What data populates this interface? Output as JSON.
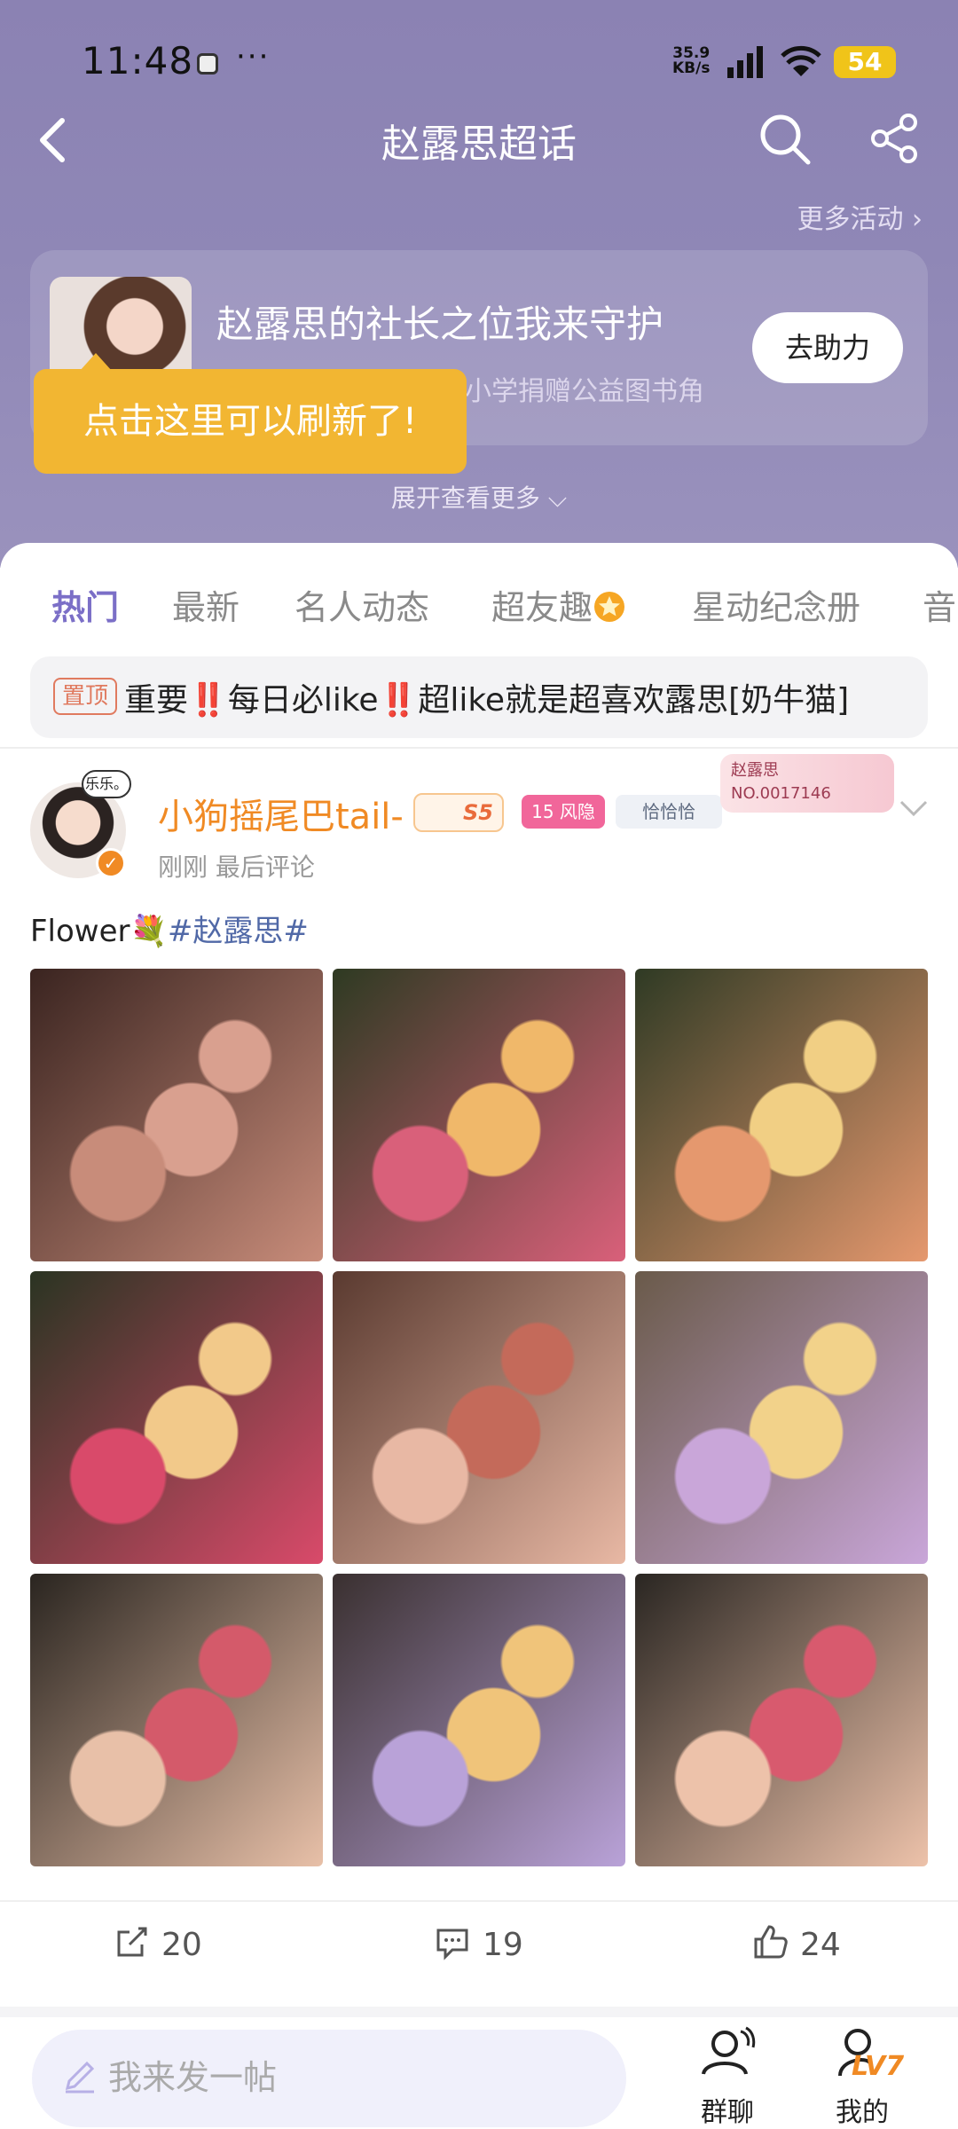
{
  "status_bar": {
    "time": "11:48",
    "dots": "···",
    "net_speed_value": "35.9",
    "net_speed_unit": "KB/s",
    "battery": "54"
  },
  "nav": {
    "title": "赵露思超话"
  },
  "activity": {
    "more_label": "更多活动 ›",
    "title": "赵露思的社长之位我来守护",
    "subtitle": "小学捐赠公益图书角",
    "help_button": "去助力",
    "tooltip": "点击这里可以刷新了!",
    "expand_label": "展开查看更多 ⌵"
  },
  "tabs": [
    {
      "label": "热门",
      "active": true
    },
    {
      "label": "最新"
    },
    {
      "label": "名人动态"
    },
    {
      "label": "超友趣"
    },
    {
      "label": "星动纪念册"
    },
    {
      "label": "音"
    }
  ],
  "pinned": {
    "tag": "置顶",
    "text": "重要‼️每日必like‼️超like就是超喜欢露思[奶牛猫]"
  },
  "post": {
    "avatar_bubble": "乐乐。",
    "username": "小狗摇尾巴tail-",
    "badge_s5": "S5",
    "level_badge": "15 风隐",
    "group_badge": "恰恰恰",
    "fan_card_name": "赵露思",
    "fan_card_no": "NO.0017146",
    "meta": "刚刚  最后评论",
    "text_plain": "Flower💐",
    "hashtag": "#赵露思#",
    "photos": [
      {
        "name": "photo-1",
        "colors": [
          "#3a2420",
          "#c88c7a",
          "#d9a08f"
        ]
      },
      {
        "name": "photo-2",
        "colors": [
          "#2e3a22",
          "#d9607a",
          "#f0b86a"
        ]
      },
      {
        "name": "photo-3",
        "colors": [
          "#2f3a24",
          "#e5986e",
          "#f1cf84"
        ]
      },
      {
        "name": "photo-4",
        "colors": [
          "#2a3422",
          "#d94a6a",
          "#f2c98a"
        ]
      },
      {
        "name": "photo-5",
        "colors": [
          "#5a3a30",
          "#e8b8a4",
          "#c46a5a"
        ]
      },
      {
        "name": "photo-6",
        "colors": [
          "#6a5a4a",
          "#c9a6d9",
          "#f2d28a"
        ]
      },
      {
        "name": "photo-7",
        "colors": [
          "#2a2520",
          "#e8c0a8",
          "#d45a6a"
        ]
      },
      {
        "name": "photo-8",
        "colors": [
          "#3a3030",
          "#b9a2d8",
          "#f0c47a"
        ]
      },
      {
        "name": "photo-9",
        "colors": [
          "#2a2622",
          "#edc2aa",
          "#d85a6e"
        ]
      }
    ],
    "shares": "20",
    "comments": "19",
    "likes": "24"
  },
  "bottom": {
    "compose_placeholder": "我来发一帖",
    "group_chat": "群聊",
    "mine": "我的",
    "level": "LV7"
  }
}
